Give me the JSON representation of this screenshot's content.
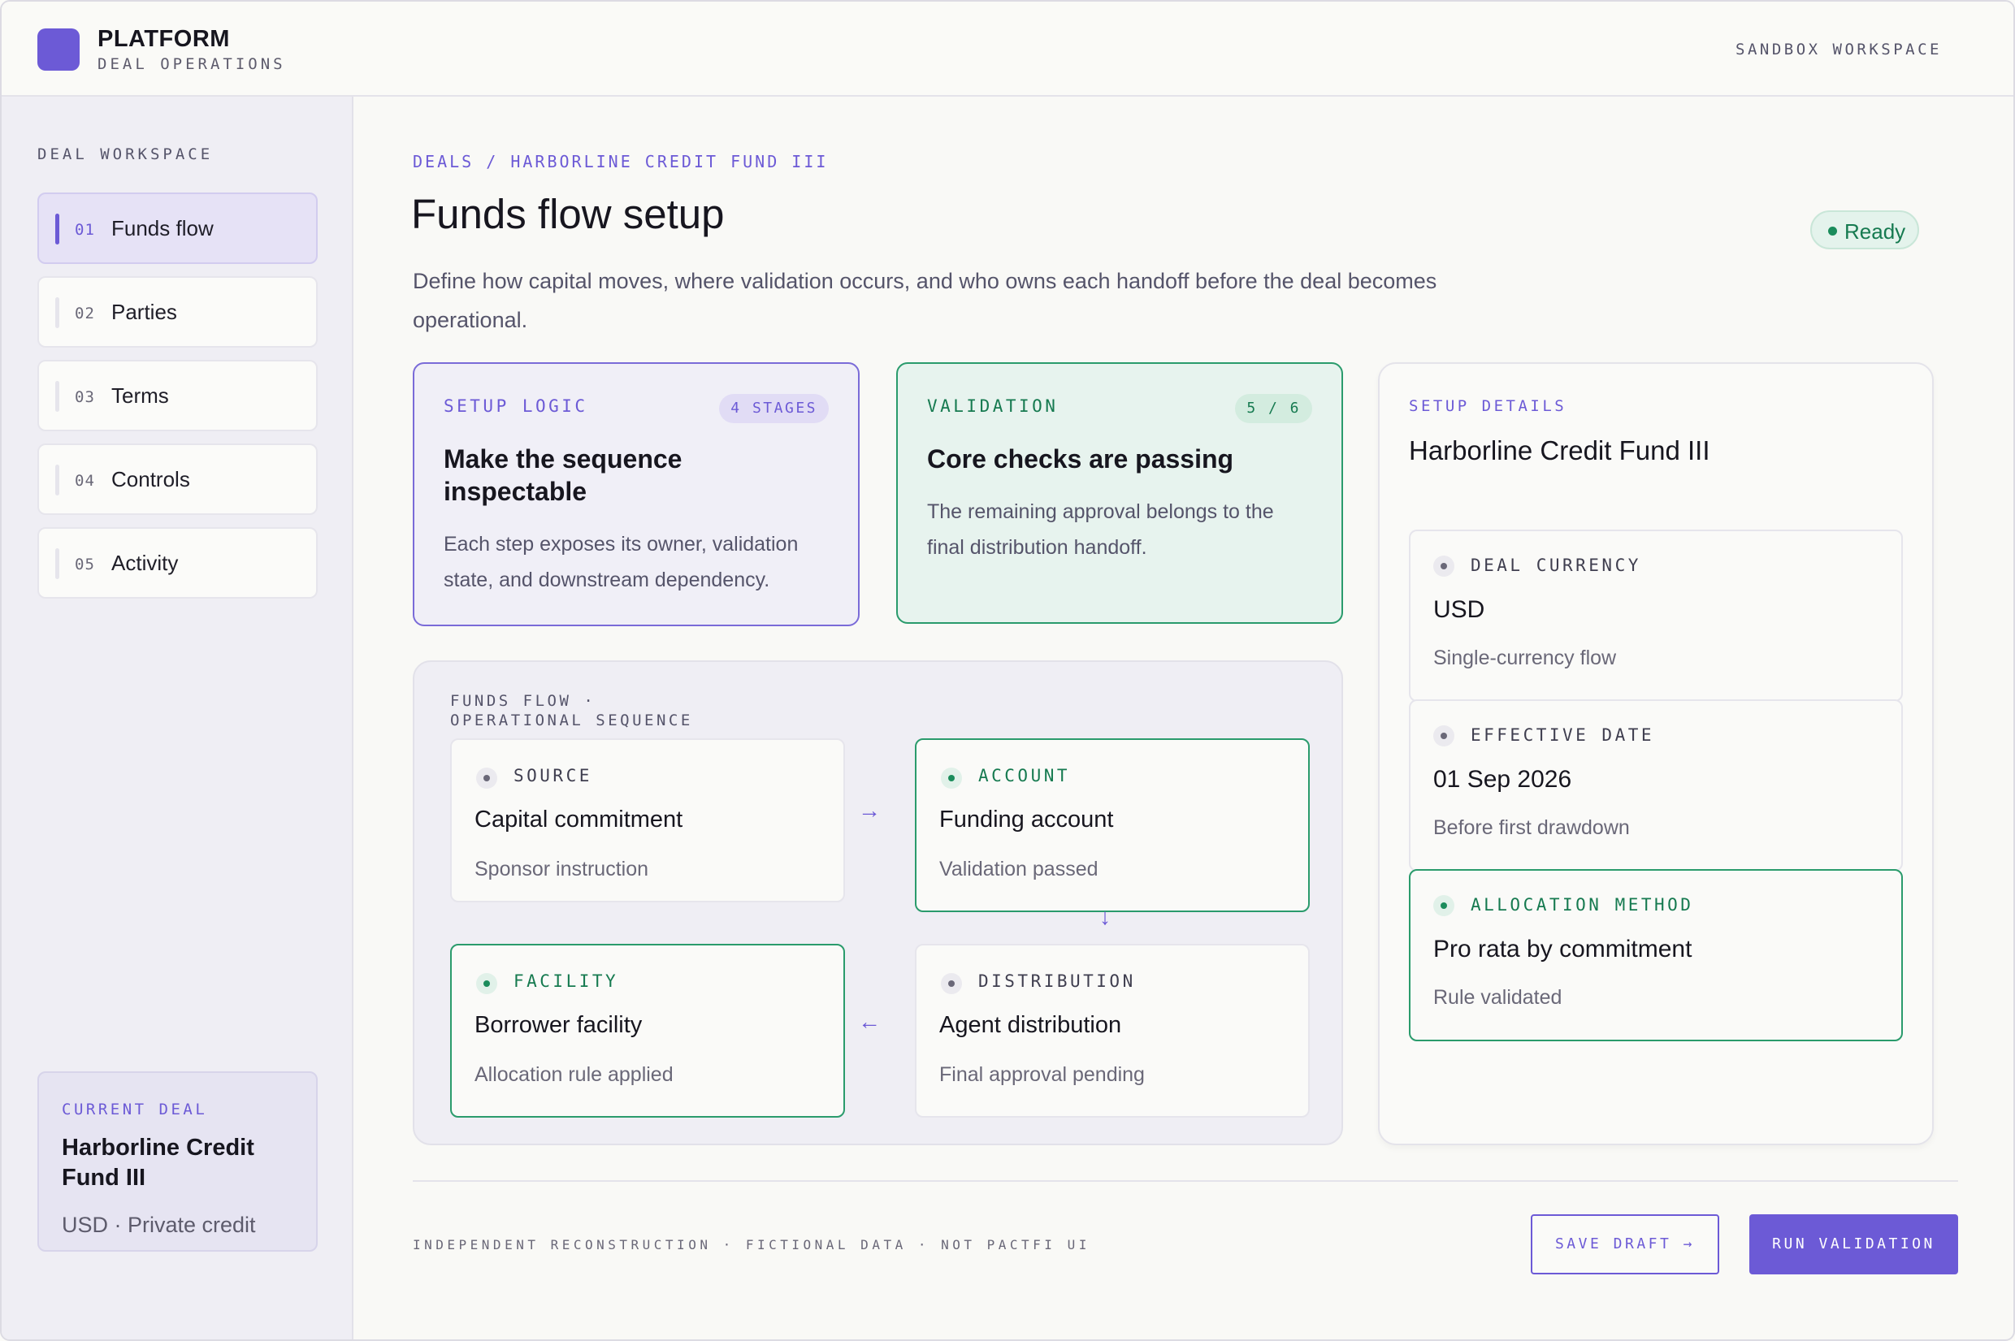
{
  "header": {
    "brand_title": "PLATFORM",
    "brand_subtitle": "DEAL OPERATIONS",
    "workspace_label": "SANDBOX WORKSPACE"
  },
  "sidebar": {
    "heading": "DEAL WORKSPACE",
    "items": [
      {
        "num": "01",
        "label": "Funds flow",
        "active": true
      },
      {
        "num": "02",
        "label": "Parties",
        "active": false
      },
      {
        "num": "03",
        "label": "Terms",
        "active": false
      },
      {
        "num": "04",
        "label": "Controls",
        "active": false
      },
      {
        "num": "05",
        "label": "Activity",
        "active": false
      }
    ],
    "current_deal": {
      "label": "CURRENT DEAL",
      "name": "Harborline Credit Fund III",
      "meta": "USD · Private credit"
    }
  },
  "main": {
    "breadcrumb": "DEALS / HARBORLINE CREDIT FUND III",
    "title": "Funds flow setup",
    "status": "Ready",
    "description": "Define how capital moves, where validation occurs, and who owns each handoff before the deal becomes operational.",
    "cards": {
      "logic": {
        "kicker": "SETUP LOGIC",
        "badge": "4 STAGES",
        "title": "Make the sequence inspectable",
        "body": "Each step exposes its owner, validation state, and downstream dependency."
      },
      "validation": {
        "kicker": "VALIDATION",
        "badge": "5 / 6",
        "title": "Core checks are passing",
        "body": "The remaining approval belongs to the final distribution handoff."
      }
    },
    "flow": {
      "heading": "FUNDS FLOW · OPERATIONAL SEQUENCE",
      "nodes": [
        {
          "kicker": "SOURCE",
          "title": "Capital commitment",
          "sub": "Sponsor instruction",
          "status": "neutral"
        },
        {
          "kicker": "ACCOUNT",
          "title": "Funding account",
          "sub": "Validation passed",
          "status": "ok"
        },
        {
          "kicker": "FACILITY",
          "title": "Borrower facility",
          "sub": "Allocation rule applied",
          "status": "ok"
        },
        {
          "kicker": "DISTRIBUTION",
          "title": "Agent distribution",
          "sub": "Final approval pending",
          "status": "neutral"
        }
      ],
      "arrows": {
        "right": "→",
        "down": "↓",
        "left": "←"
      }
    },
    "details": {
      "kicker": "SETUP DETAILS",
      "title": "Harborline Credit Fund III",
      "fields": [
        {
          "key": "DEAL CURRENCY",
          "value": "USD",
          "sub": "Single-currency flow",
          "status": "neutral"
        },
        {
          "key": "EFFECTIVE DATE",
          "value": "01 Sep 2026",
          "sub": "Before first drawdown",
          "status": "neutral"
        },
        {
          "key": "ALLOCATION METHOD",
          "value": "Pro rata by commitment",
          "sub": "Rule validated",
          "status": "ok"
        }
      ]
    }
  },
  "footer": {
    "note": "INDEPENDENT RECONSTRUCTION · FICTIONAL DATA · NOT PACTFI UI",
    "save_label": "SAVE DRAFT →",
    "run_label": "RUN VALIDATION"
  },
  "colors": {
    "accent": "#6c5ad6",
    "success": "#1a8c5b",
    "success_border": "#2a9b6c",
    "text_primary": "#17161f",
    "text_muted": "#55546a"
  },
  "icons": {
    "logo": "rounded-square-logo",
    "status_dot": "dot-icon",
    "arrows": [
      "arrow-right-icon",
      "arrow-down-icon",
      "arrow-left-icon"
    ]
  }
}
